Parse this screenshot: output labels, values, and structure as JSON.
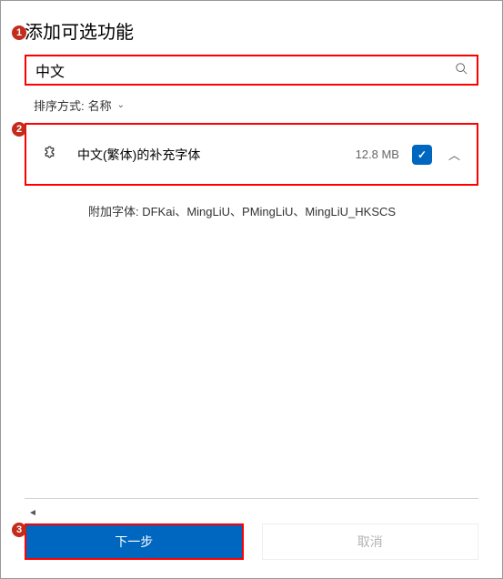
{
  "title": "添加可选功能",
  "search": {
    "value": "中文",
    "placeholder": ""
  },
  "sort": {
    "label": "排序方式:",
    "value": "名称"
  },
  "feature": {
    "name": "中文(繁体)的补充字体",
    "size": "12.8 MB",
    "detail": "附加字体: DFKai、MingLiU、PMingLiU、MingLiU_HKSCS"
  },
  "buttons": {
    "next": "下一步",
    "cancel": "取消"
  },
  "annotations": {
    "a1": "1",
    "a2": "2",
    "a3": "3"
  }
}
